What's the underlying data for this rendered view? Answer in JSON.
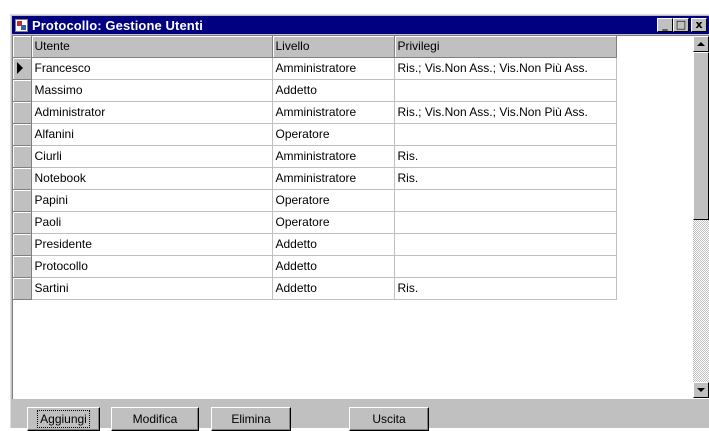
{
  "window": {
    "title": "Protocollo: Gestione Utenti",
    "caption_buttons": [
      "_",
      "□",
      "x"
    ]
  },
  "grid": {
    "columns": [
      "Utente",
      "Livello",
      "Privilegi"
    ],
    "current_row": 0,
    "rows": [
      [
        "Francesco",
        "Amministratore",
        "Ris.; Vis.Non Ass.; Vis.Non Più Ass."
      ],
      [
        "Massimo",
        "Addetto",
        ""
      ],
      [
        "Administrator",
        "Amministratore",
        "Ris.; Vis.Non Ass.; Vis.Non Più Ass."
      ],
      [
        "Alfanini",
        "Operatore",
        ""
      ],
      [
        "Ciurli",
        "Amministratore",
        "Ris."
      ],
      [
        "Notebook",
        "Amministratore",
        "Ris."
      ],
      [
        "Papini",
        "Operatore",
        ""
      ],
      [
        "Paoli",
        "Operatore",
        ""
      ],
      [
        "Presidente",
        "Addetto",
        ""
      ],
      [
        "Protocollo",
        "Addetto",
        ""
      ],
      [
        "Sartini",
        "Addetto",
        "Ris."
      ]
    ]
  },
  "buttons": {
    "aggiungi": "Aggiungi",
    "modifica": "Modifica",
    "elimina": "Elimina",
    "uscita": "Uscita"
  },
  "colors": {
    "titlebar": "#000080",
    "face": "#c0c0c0"
  }
}
